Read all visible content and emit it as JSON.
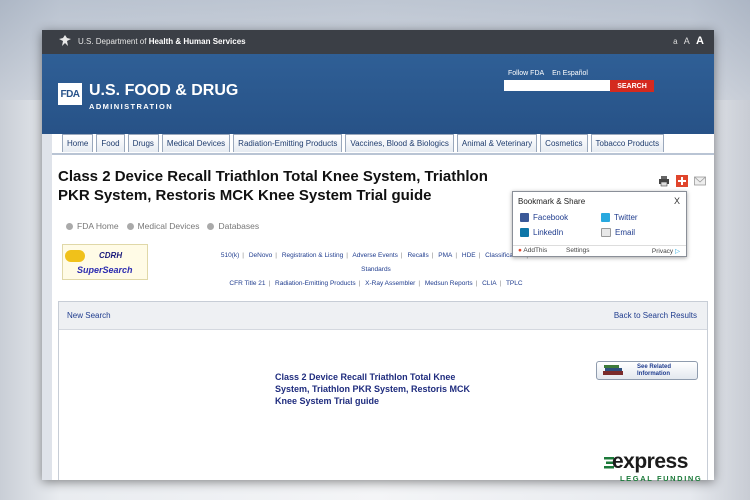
{
  "hhs_bar": {
    "prefix": "U.S. Department of ",
    "bold": "Health & Human Services",
    "text_size": [
      "a",
      "A",
      "A"
    ]
  },
  "header": {
    "logo_mark": "FDA",
    "title": "U.S. FOOD & DRUG",
    "subtitle": "ADMINISTRATION",
    "follow_fda": "Follow FDA",
    "en_espanol": "En Español",
    "search_placeholder": "",
    "search_button": "SEARCH"
  },
  "nav": {
    "tabs": [
      "Home",
      "Food",
      "Drugs",
      "Medical Devices",
      "Radiation-Emitting Products",
      "Vaccines, Blood & Biologics",
      "Animal & Veterinary",
      "Cosmetics",
      "Tobacco Products"
    ]
  },
  "page": {
    "title": "Class 2 Device Recall Triathlon Total Knee System, Triathlon PKR System, Restoris MCK Knee System Trial guide",
    "breadcrumb": [
      "FDA Home",
      "Medical Devices",
      "Databases"
    ]
  },
  "cdrh": {
    "logo_line1": "CDRH",
    "logo_line2": "SuperSearch"
  },
  "db_links": {
    "row1": [
      "510(k)",
      "DeNovo",
      "Registration & Listing",
      "Adverse Events",
      "Recalls",
      "PMA",
      "HDE",
      "Classification",
      "Standards"
    ],
    "row2": [
      "CFR Title 21",
      "Radiation-Emitting Products",
      "X-Ray Assembler",
      "Medsun Reports",
      "CLIA",
      "TPLC"
    ]
  },
  "results": {
    "new_search": "New Search",
    "back_to_results": "Back to Search Results",
    "title": "Class 2 Device Recall Triathlon Total Knee System, Triathlon PKR System, Restoris MCK Knee System Trial guide",
    "see_related_line1": "See Related",
    "see_related_line2": "Information"
  },
  "share": {
    "heading": "Bookmark & Share",
    "close": "X",
    "facebook": "Facebook",
    "twitter": "Twitter",
    "linkedin": "LinkedIn",
    "email": "Email",
    "addthis": "AddThis",
    "settings": "Settings",
    "privacy": "Privacy"
  },
  "watermark": {
    "word": "express",
    "sub": "LEGAL FUNDING"
  },
  "colors": {
    "header_blue": "#275287",
    "search_red": "#d42a1f",
    "link_blue": "#1f3c8e",
    "express_green": "#1c7a3a"
  }
}
